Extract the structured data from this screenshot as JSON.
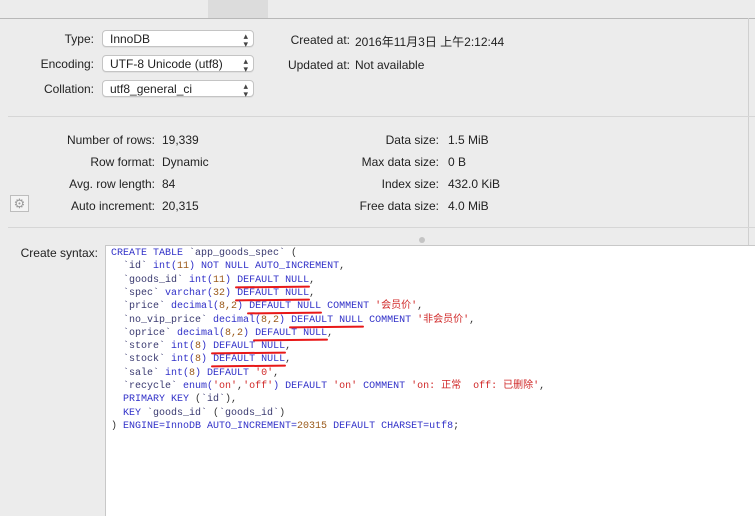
{
  "options": {
    "type_label": "Type:",
    "type_value": "InnoDB",
    "encoding_label": "Encoding:",
    "encoding_value": "UTF-8 Unicode (utf8)",
    "collation_label": "Collation:",
    "collation_value": "utf8_general_ci",
    "created_label": "Created at:",
    "created_value": "2016年11月3日 上午2:12:44",
    "updated_label": "Updated at:",
    "updated_value": "Not available"
  },
  "stats": {
    "left": [
      {
        "label": "Number of rows:",
        "value": "19,339"
      },
      {
        "label": "Row format:",
        "value": "Dynamic"
      },
      {
        "label": "Avg. row length:",
        "value": "84"
      },
      {
        "label": "Auto increment:",
        "value": "20,315"
      }
    ],
    "right": [
      {
        "label": "Data size:",
        "value": "1.5 MiB"
      },
      {
        "label": "Max data size:",
        "value": "0 B"
      },
      {
        "label": "Index size:",
        "value": "432.0 KiB"
      },
      {
        "label": "Free data size:",
        "value": "4.0 MiB"
      }
    ]
  },
  "syntax_label": "Create syntax:",
  "sql_lines": [
    [
      [
        "kw",
        "CREATE TABLE "
      ],
      [
        "id",
        "`app_goods_spec`"
      ],
      [
        "pl",
        " ("
      ]
    ],
    [
      [
        "id",
        "  `id`"
      ],
      [
        "kw",
        " int("
      ],
      [
        "num",
        "11"
      ],
      [
        "kw",
        ") NOT NULL AUTO_INCREMENT"
      ],
      [
        "pl",
        ","
      ]
    ],
    [
      [
        "id",
        "  `goods_id`"
      ],
      [
        "kw",
        " int("
      ],
      [
        "num",
        "11"
      ],
      [
        "kw",
        ")"
      ],
      [
        "kw",
        " "
      ],
      [
        "kwu",
        "DEFAULT NULL"
      ],
      [
        "pl",
        ","
      ]
    ],
    [
      [
        "id",
        "  `spec`"
      ],
      [
        "kw",
        " varchar("
      ],
      [
        "num",
        "32"
      ],
      [
        "kw",
        ") "
      ],
      [
        "kwu",
        "DEFAULT NULL"
      ],
      [
        "pl",
        ","
      ]
    ],
    [
      [
        "id",
        "  `price`"
      ],
      [
        "kw",
        " decimal("
      ],
      [
        "num",
        "8,2"
      ],
      [
        "kw",
        ") "
      ],
      [
        "kwu",
        "DEFAULT NULL"
      ],
      [
        "kw",
        " COMMENT "
      ],
      [
        "str",
        "'会员价'"
      ],
      [
        "pl",
        ","
      ]
    ],
    [
      [
        "id",
        "  `no_vip_price`"
      ],
      [
        "kw",
        " decimal("
      ],
      [
        "num",
        "8,2"
      ],
      [
        "kw",
        ") "
      ],
      [
        "kwu",
        "DEFAULT NULL"
      ],
      [
        "kw",
        " COMMENT "
      ],
      [
        "str",
        "'非会员价'"
      ],
      [
        "pl",
        ","
      ]
    ],
    [
      [
        "id",
        "  `oprice`"
      ],
      [
        "kw",
        " decimal("
      ],
      [
        "num",
        "8,2"
      ],
      [
        "kw",
        ") "
      ],
      [
        "kwu",
        "DEFAULT NULL"
      ],
      [
        "pl",
        ","
      ]
    ],
    [
      [
        "id",
        "  `store`"
      ],
      [
        "kw",
        " int("
      ],
      [
        "num",
        "8"
      ],
      [
        "kw",
        ") "
      ],
      [
        "kwu",
        "DEFAULT NULL"
      ],
      [
        "pl",
        ","
      ]
    ],
    [
      [
        "id",
        "  `stock`"
      ],
      [
        "kw",
        " int("
      ],
      [
        "num",
        "8"
      ],
      [
        "kw",
        ") "
      ],
      [
        "kwu",
        "DEFAULT NULL"
      ],
      [
        "pl",
        ","
      ]
    ],
    [
      [
        "id",
        "  `sale`"
      ],
      [
        "kw",
        " int("
      ],
      [
        "num",
        "8"
      ],
      [
        "kw",
        ") DEFAULT "
      ],
      [
        "str",
        "'0'"
      ],
      [
        "pl",
        ","
      ]
    ],
    [
      [
        "id",
        "  `recycle`"
      ],
      [
        "kw",
        " enum("
      ],
      [
        "str",
        "'on'"
      ],
      [
        "pl",
        ","
      ],
      [
        "str",
        "'off'"
      ],
      [
        "kw",
        ") DEFAULT "
      ],
      [
        "str",
        "'on'"
      ],
      [
        "kw",
        " COMMENT "
      ],
      [
        "str",
        "'on: 正常  off: 已删除'"
      ],
      [
        "pl",
        ","
      ]
    ],
    [
      [
        "kw",
        "  PRIMARY KEY "
      ],
      [
        "pl",
        "("
      ],
      [
        "id",
        "`id`"
      ],
      [
        "pl",
        "),"
      ]
    ],
    [
      [
        "kw",
        "  KEY "
      ],
      [
        "id",
        "`goods_id`"
      ],
      [
        "pl",
        " ("
      ],
      [
        "id",
        "`goods_id`"
      ],
      [
        "pl",
        ")"
      ]
    ],
    [
      [
        "pl",
        ") "
      ],
      [
        "kw",
        "ENGINE=InnoDB AUTO_INCREMENT="
      ],
      [
        "num",
        "20315"
      ],
      [
        "kw",
        " DEFAULT CHARSET=utf8"
      ],
      [
        "pl",
        ";"
      ]
    ]
  ]
}
